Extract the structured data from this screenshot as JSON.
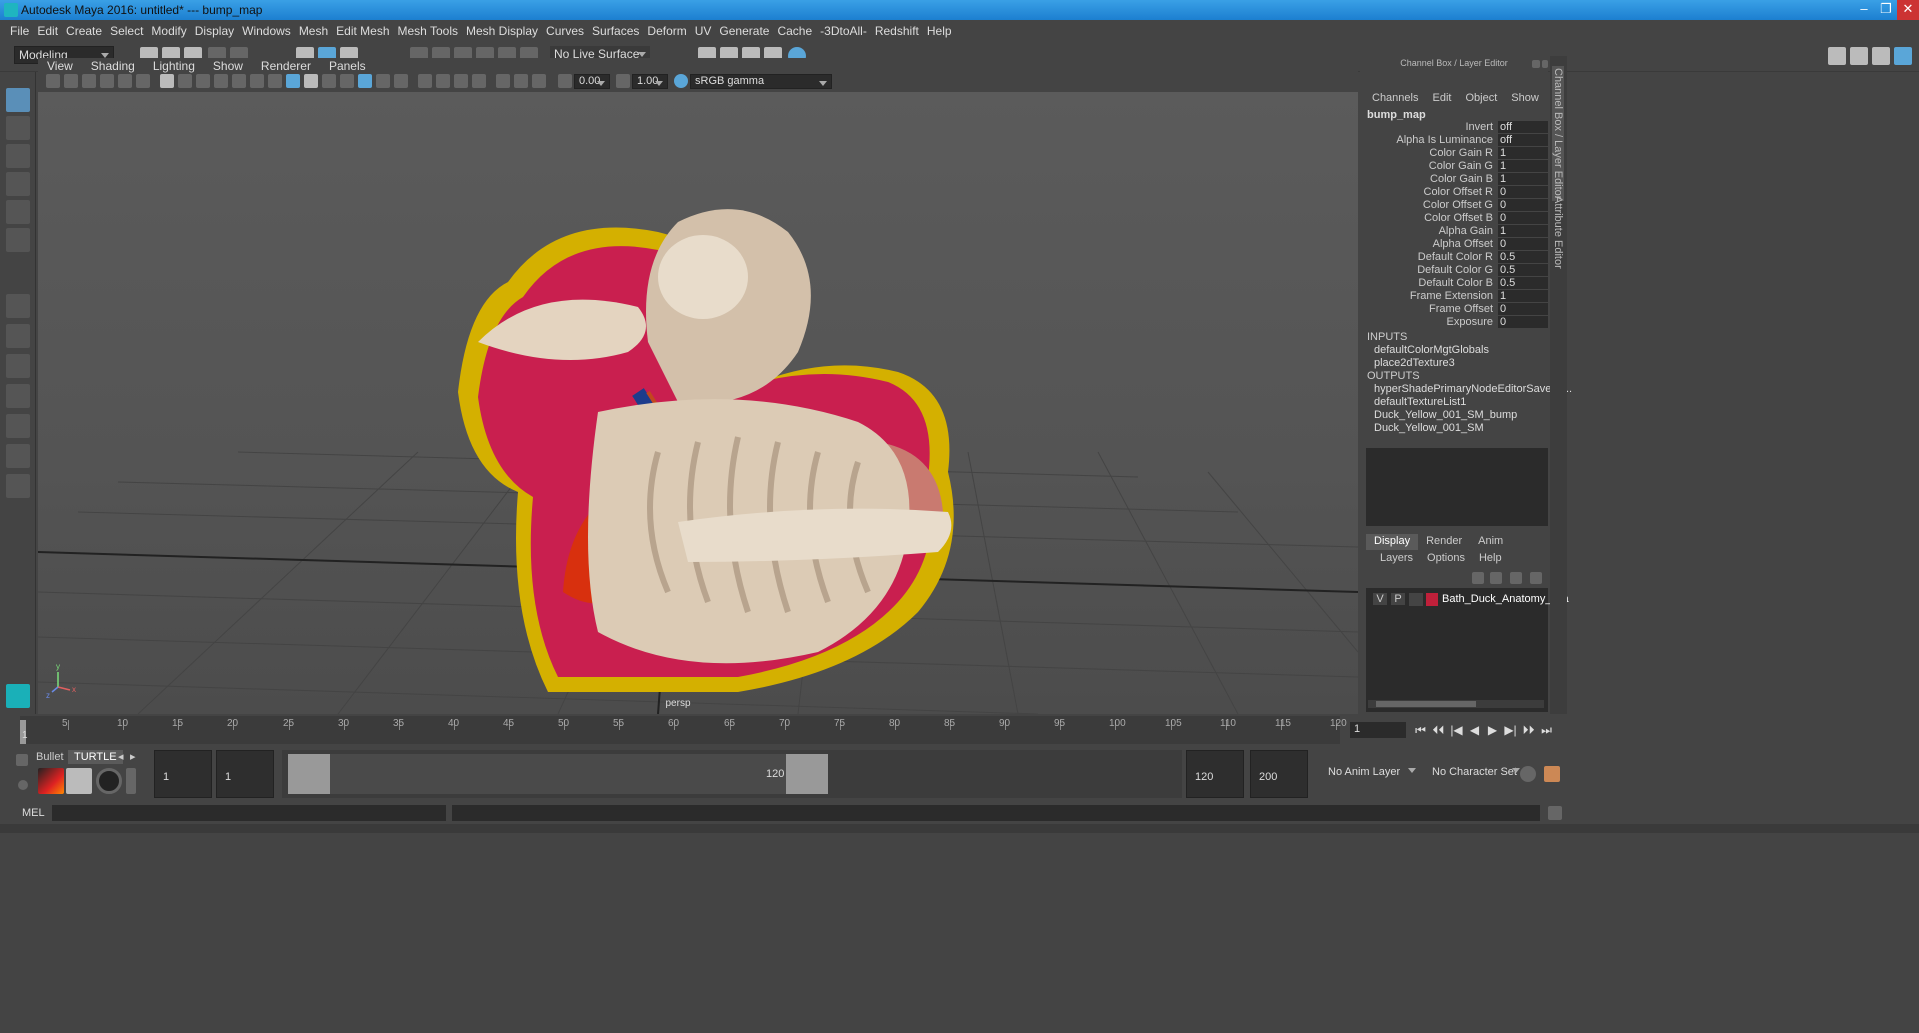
{
  "titlebar": {
    "title": "Autodesk Maya 2016: untitled*   ---   bump_map",
    "minimize": "–",
    "restore": "❐",
    "close": "✕"
  },
  "menubar": [
    "File",
    "Edit",
    "Create",
    "Select",
    "Modify",
    "Display",
    "Windows",
    "Mesh",
    "Edit Mesh",
    "Mesh Tools",
    "Mesh Display",
    "Curves",
    "Surfaces",
    "Deform",
    "UV",
    "Generate",
    "Cache",
    "-3DtoAll-",
    "Redshift",
    "Help"
  ],
  "status": {
    "mode": "Modeling",
    "live_surface": "No Live Surface"
  },
  "viewport": {
    "menu": [
      "View",
      "Shading",
      "Lighting",
      "Show",
      "Renderer",
      "Panels"
    ],
    "exposure": "0.00",
    "gamma": "1.00",
    "colorspace": "sRGB gamma",
    "camera": "persp",
    "axis_y": "y",
    "axis_x": "x",
    "axis_z": "z"
  },
  "channel_box": {
    "header": "Channel Box / Layer Editor",
    "menu": [
      "Channels",
      "Edit",
      "Object",
      "Show"
    ],
    "node": "bump_map",
    "attributes": [
      {
        "name": "Invert",
        "value": "off"
      },
      {
        "name": "Alpha Is Luminance",
        "value": "off"
      },
      {
        "name": "Color Gain R",
        "value": "1"
      },
      {
        "name": "Color Gain G",
        "value": "1"
      },
      {
        "name": "Color Gain B",
        "value": "1"
      },
      {
        "name": "Color Offset R",
        "value": "0"
      },
      {
        "name": "Color Offset G",
        "value": "0"
      },
      {
        "name": "Color Offset B",
        "value": "0"
      },
      {
        "name": "Alpha Gain",
        "value": "1"
      },
      {
        "name": "Alpha Offset",
        "value": "0"
      },
      {
        "name": "Default Color R",
        "value": "0.5"
      },
      {
        "name": "Default Color G",
        "value": "0.5"
      },
      {
        "name": "Default Color B",
        "value": "0.5"
      },
      {
        "name": "Frame Extension",
        "value": "1"
      },
      {
        "name": "Frame Offset",
        "value": "0"
      },
      {
        "name": "Exposure",
        "value": "0"
      }
    ],
    "inputs_label": "INPUTS",
    "inputs": [
      "defaultColorMgtGlobals",
      "place2dTexture3"
    ],
    "outputs_label": "OUTPUTS",
    "outputs": [
      "hyperShadePrimaryNodeEditorSavedT...",
      "defaultTextureList1",
      "Duck_Yellow_001_SM_bump",
      "Duck_Yellow_001_SM"
    ]
  },
  "layer_editor": {
    "tabs": [
      "Display",
      "Render",
      "Anim"
    ],
    "menu": [
      "Layers",
      "Options",
      "Help"
    ],
    "layer": {
      "v": "V",
      "p": "P",
      "name": "Bath_Duck_Anatomy_Gla",
      "color": "#c0203a"
    }
  },
  "side_tabs": [
    "Channel Box / Layer Editor",
    "Attribute Editor"
  ],
  "timeline": {
    "ticks": [
      "5",
      "10",
      "15",
      "20",
      "25",
      "30",
      "35",
      "40",
      "45",
      "50",
      "55",
      "60",
      "65",
      "70",
      "75",
      "80",
      "85",
      "90",
      "95",
      "100",
      "105",
      "110",
      "115",
      "120"
    ],
    "current_frame": "1",
    "start_label": "1",
    "frame_field": "1",
    "playback": [
      "⏮",
      "⏴⏴",
      "|◀",
      "◀",
      "▶",
      "▶|",
      "⏵⏵",
      "⏭"
    ]
  },
  "range": {
    "shelf_tabs": [
      "Bullet",
      "TURTLE"
    ],
    "start": "1",
    "play_start": "1",
    "range_start": "1",
    "range_end": "120",
    "play_end": "120",
    "end": "200",
    "anim_layer": "No Anim Layer",
    "char_set": "No Character Set"
  },
  "cmdline": {
    "label": "MEL"
  }
}
